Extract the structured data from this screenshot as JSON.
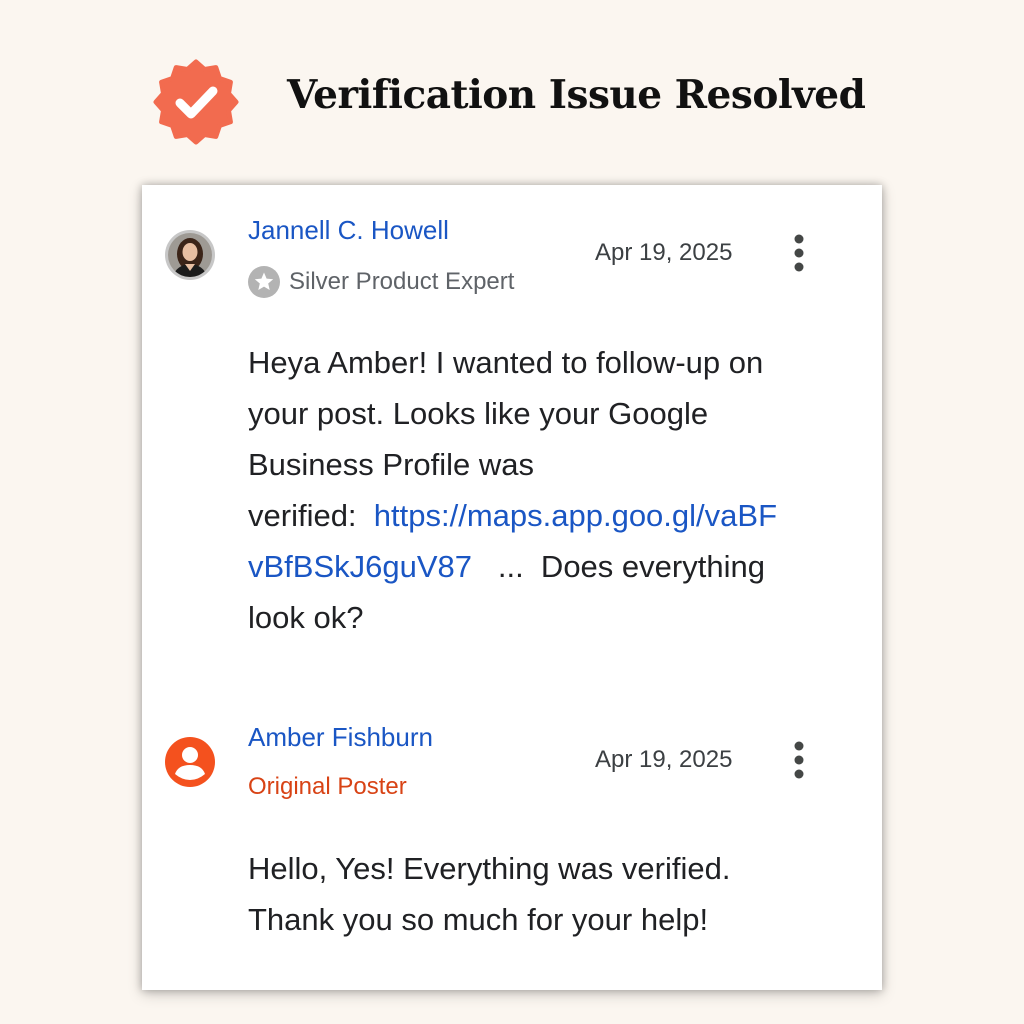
{
  "header": {
    "title": "Verification Issue Resolved",
    "badge_icon": "check-badge-icon",
    "badge_color": "#f26b4f"
  },
  "thread": {
    "posts": [
      {
        "author": "Jannell C. Howell",
        "role": "Silver Product Expert",
        "role_icon": "star-badge-icon",
        "date": "Apr 19, 2025",
        "body_line1": "Heya Amber!  I wanted to follow-up on",
        "body_line2": "your post.  Looks like your Google",
        "body_line3": "Business Profile was",
        "body_line4_prefix": "verified:  ",
        "link_part1": "https://maps.app.goo.gl/vaBF",
        "link_part2": "vBfBSkJ6guV87",
        "body_line5_suffix": "   ...  Does everything",
        "body_line6": "look ok?"
      },
      {
        "author": "Amber Fishburn",
        "role": "Original Poster",
        "date": "Apr 19, 2025",
        "body_line1": "Hello, Yes! Everything was verified.",
        "body_line2": "Thank you so much for your help!"
      }
    ]
  },
  "colors": {
    "link": "#1a56c4",
    "original_poster": "#d84315",
    "avatar_default": "#f4511e",
    "background": "#fbf6f0"
  }
}
